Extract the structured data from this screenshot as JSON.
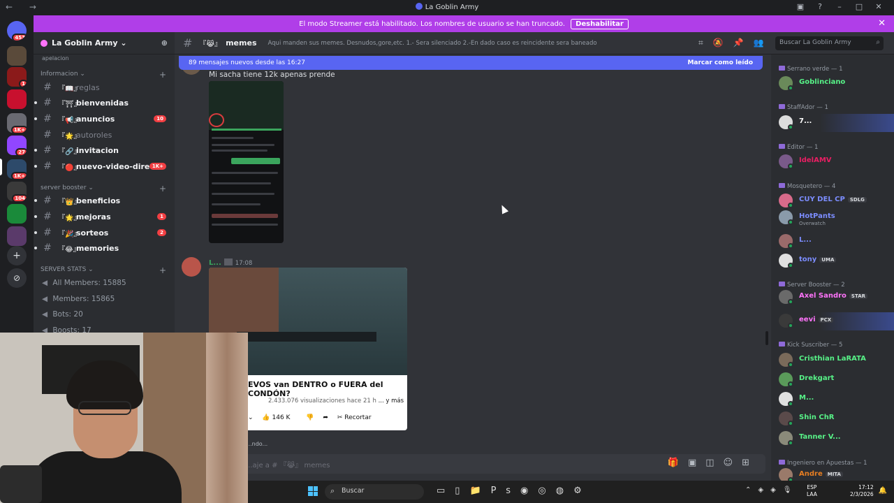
{
  "window": {
    "title": "La Goblin Army",
    "controls": [
      "▣",
      "?",
      "–",
      "□",
      "✕"
    ],
    "nav": "← →"
  },
  "guilds": [
    {
      "color": "#5865f2",
      "badge": "453"
    },
    {
      "color": "#5a4a3a",
      "badge": ""
    },
    {
      "color": "#8b1a1a",
      "badge": "1"
    },
    {
      "color": "#c8102e",
      "badge": ""
    },
    {
      "color": "#6a6a72",
      "badge": "1K+"
    },
    {
      "color": "#9146ff",
      "badge": "27"
    },
    {
      "color": "#2d4a6a",
      "badge": "1K+"
    },
    {
      "color": "#3a3a3a",
      "badge": "104"
    },
    {
      "color": "#1a8a3a",
      "badge": ""
    },
    {
      "color": "#5a3a6a",
      "badge": ""
    }
  ],
  "streamer_banner": {
    "text": "El modo Streamer está habilitado. Los nombres de usuario se han truncado.",
    "button": "Deshabilitar",
    "close": "✕"
  },
  "server": {
    "name": "La Goblin Army ⌄",
    "scrolled_item": "apelacion"
  },
  "categories": {
    "info": "Informacion ⌄",
    "booster": "server booster ⌄",
    "stats": "SERVER STATS ⌄"
  },
  "channels": [
    {
      "emoji": "『📖』",
      "name": "reglas",
      "unread": false,
      "badge": ""
    },
    {
      "emoji": "『⛩』",
      "name": "bienvenidas",
      "unread": true,
      "badge": ""
    },
    {
      "emoji": "『📢』",
      "name": "anuncios",
      "unread": true,
      "badge": "10"
    },
    {
      "emoji": "『🌟』",
      "name": "autoroles",
      "unread": false,
      "badge": ""
    },
    {
      "emoji": "『🔗』",
      "name": "invitacion",
      "unread": true,
      "badge": ""
    },
    {
      "emoji": "『🔴』",
      "name": "nuevo-video-direc...",
      "unread": true,
      "badge": "1K+"
    },
    {
      "emoji": "『👑』",
      "name": "beneficios",
      "unread": true,
      "badge": ""
    },
    {
      "emoji": "『🌟』",
      "name": "mejoras",
      "unread": true,
      "badge": "1"
    },
    {
      "emoji": "『🎉』",
      "name": "sorteos",
      "unread": true,
      "badge": "2"
    },
    {
      "emoji": "『😂』",
      "name": "memories",
      "unread": true,
      "badge": ""
    }
  ],
  "stats": [
    "All Members: 15885",
    "Members: 15865",
    "Bots: 20",
    "Boosts: 17"
  ],
  "channel_header": {
    "emoji": "『😹』",
    "name": "memes",
    "topic": "Aqui manden sus memes. Desnudos,gore,etc. 1.- Sera silenciado 2.-En dado caso es reincidente sera baneado",
    "search_placeholder": "Buscar La Goblin Army"
  },
  "new_messages": {
    "text": "89 mensajes nuevos desde las 16:27",
    "mark_read": "Marcar como leído"
  },
  "messages": [
    {
      "text": "Mi sacha tiene 12k apenas prende"
    },
    {
      "author": "L...",
      "time": "17:08"
    }
  ],
  "youtube_embed": {
    "title": "EVOS van DENTRO o FUERA del CONDÓN?",
    "views": "2.433.076 visualizaciones hace 21 h",
    "more": "... y más",
    "likes": "146 K",
    "clip": "Recortar"
  },
  "typing": "...ndo...",
  "composer": {
    "placeholder": "...aje a # 『😹』 memes"
  },
  "member_categories": [
    {
      "label": "Serrano verde — 1"
    },
    {
      "label": "StaffAdor — 1"
    },
    {
      "label": "Editor — 1"
    },
    {
      "label": "Mosquetero — 4"
    },
    {
      "label": "Server Booster — 2"
    },
    {
      "label": "Kick Suscriber — 5"
    },
    {
      "label": "Ingeniero en Apuestas — 1"
    }
  ],
  "members": [
    {
      "name": "Goblinciano",
      "color": "#57f287",
      "tag": "",
      "sub": ""
    },
    {
      "name": "7...",
      "color": "#ffffff",
      "tag": "",
      "sub": ""
    },
    {
      "name": "IdelAMV",
      "color": "#e91e63",
      "tag": "",
      "sub": ""
    },
    {
      "name": "CUY DEL CP",
      "color": "#7c8dff",
      "tag": "SDLG",
      "sub": ""
    },
    {
      "name": "HotPants",
      "color": "#7c8dff",
      "tag": "",
      "sub": "Overwatch"
    },
    {
      "name": "L...",
      "color": "#7c8dff",
      "tag": "",
      "sub": ""
    },
    {
      "name": "tony",
      "color": "#7c8dff",
      "tag": "UMA",
      "sub": ""
    },
    {
      "name": "Axel Sandro",
      "color": "#ff73fa",
      "tag": "STAR",
      "sub": ""
    },
    {
      "name": "eevi",
      "color": "#ff73fa",
      "tag": "PCX",
      "sub": ""
    },
    {
      "name": "Cristhian LaRATA",
      "color": "#57f287",
      "tag": "",
      "sub": ""
    },
    {
      "name": "Drekgart",
      "color": "#57f287",
      "tag": "",
      "sub": ""
    },
    {
      "name": "M...",
      "color": "#57f287",
      "tag": "",
      "sub": ""
    },
    {
      "name": "Shin ChR",
      "color": "#57f287",
      "tag": "",
      "sub": ""
    },
    {
      "name": "Tanner V...",
      "color": "#57f287",
      "tag": "",
      "sub": ""
    },
    {
      "name": "Andre",
      "color": "#e67e22",
      "tag": "MITA",
      "sub": ""
    }
  ],
  "taskbar": {
    "search": "Buscar",
    "lang": "ESP",
    "region": "LAA",
    "time": "17:12",
    "date": "2/3/2026"
  }
}
